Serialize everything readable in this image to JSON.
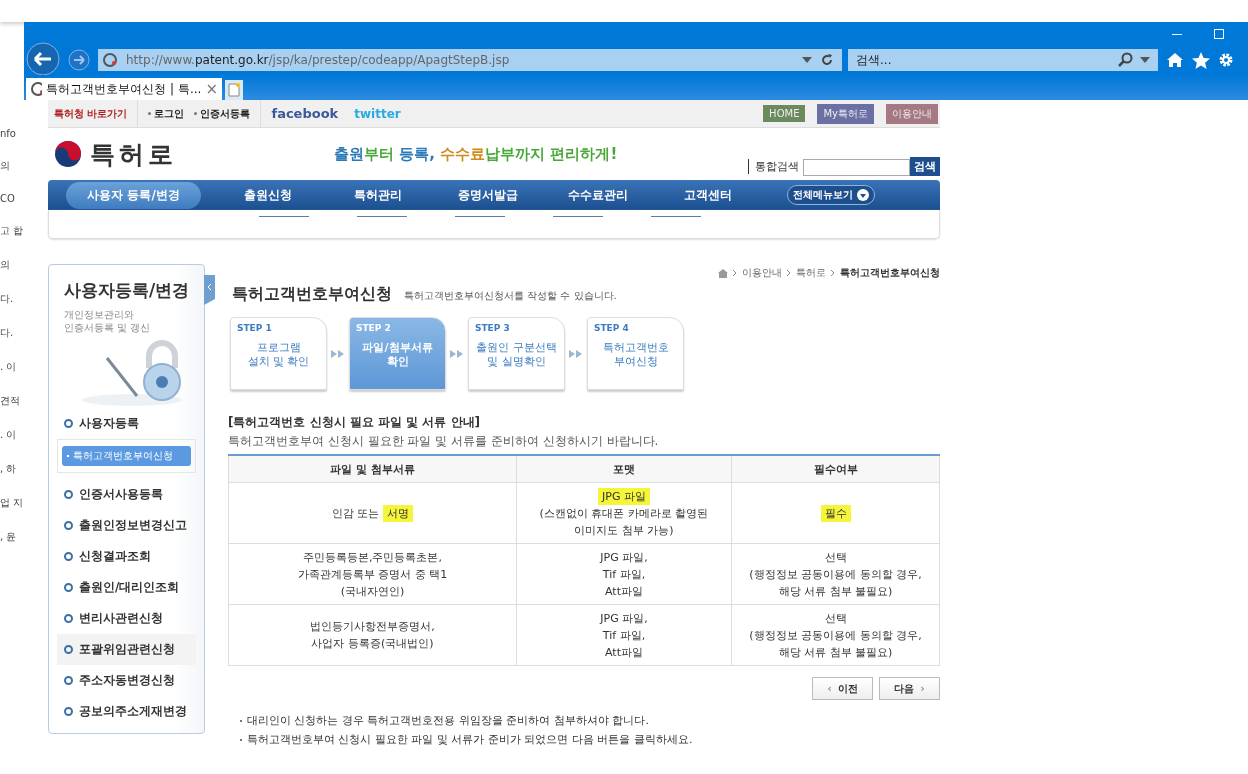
{
  "background_window": {
    "fragments": [
      "nfo",
      "의",
      "CO",
      "고 합",
      "의",
      "다.",
      "다.",
      ". 이",
      "견적",
      ". 이",
      ", 하",
      "업 지",
      ", 윤"
    ]
  },
  "browser": {
    "url": {
      "prefix": "http://www.",
      "domain": "patent.go.kr",
      "path": "/jsp/ka/prestep/codeapp/ApagtStepB.jsp"
    },
    "search": {
      "placeholder": "검색..."
    },
    "tabs": [
      {
        "title": "특허고객번호부여신청 | 특...",
        "close": "×",
        "selected": true
      }
    ]
  },
  "top_bar": {
    "shortcut": "특허청 바로가기",
    "links": [
      "로그인",
      "인증서등록"
    ],
    "social": [
      "facebook",
      "twitter"
    ],
    "buttons": [
      {
        "label": "HOME",
        "color": "#6b8a5e"
      },
      {
        "label": "My특허로",
        "color": "#6a70a3"
      },
      {
        "label": "이용안내",
        "color": "#a57882"
      }
    ]
  },
  "header": {
    "logo": "특허로",
    "slogan": [
      {
        "text": "출원",
        "color": "#2a7ab8"
      },
      {
        "text": "부터 ",
        "color": "#4aa83a"
      },
      {
        "text": "등록, ",
        "color": "#2a7ab8"
      },
      {
        "text": "수수료",
        "color": "#d08a1a"
      },
      {
        "text": "납부",
        "color": "#4aa83a"
      },
      {
        "text": "까지 편리하게!",
        "color": "#4aa83a"
      }
    ],
    "search_label": "통합검색",
    "search_button": "검색"
  },
  "nav": {
    "items": [
      {
        "label": "사용자 등록/변경",
        "selected": true
      },
      {
        "label": "출원신청",
        "selected": false
      },
      {
        "label": "특허관리",
        "selected": false
      },
      {
        "label": "증명서발급",
        "selected": false
      },
      {
        "label": "수수료관리",
        "selected": false
      },
      {
        "label": "고객센터",
        "selected": false
      }
    ],
    "all_menu": "전체메뉴보기"
  },
  "sidebar": {
    "title": "사용자등록/변경",
    "subtitle": [
      "개인정보관리와",
      "인증서등록 및 갱신"
    ],
    "items": [
      {
        "label": "사용자등록",
        "hovered": false,
        "children": [
          {
            "label": "특허고객번호부여신청",
            "selected": true
          }
        ]
      },
      {
        "label": "인증서사용등록",
        "hovered": false
      },
      {
        "label": "출원인정보변경신고",
        "hovered": false
      },
      {
        "label": "신청결과조회",
        "hovered": false
      },
      {
        "label": "출원인/대리인조회",
        "hovered": false
      },
      {
        "label": "변리사관련신청",
        "hovered": false
      },
      {
        "label": "포괄위임관련신청",
        "hovered": true
      },
      {
        "label": "주소자동변경신청",
        "hovered": false
      },
      {
        "label": "공보의주소게재변경",
        "hovered": false
      }
    ]
  },
  "breadcrumb": [
    "이용안내",
    "특허로",
    "특허고객번호부여신청"
  ],
  "page": {
    "title": "특허고객번호부여신청",
    "subtitle": "특허고객번호부여신청서를 작성할 수 있습니다."
  },
  "steps": [
    {
      "label": "STEP 1",
      "text": [
        "프로그램",
        "설치 및 확인"
      ],
      "selected": false
    },
    {
      "label": "STEP 2",
      "text": [
        "파일/첨부서류",
        "확인"
      ],
      "selected": true
    },
    {
      "label": "STEP 3",
      "text": [
        "출원인 구분선택",
        "및 실명확인"
      ],
      "selected": false
    },
    {
      "label": "STEP 4",
      "text": [
        "특허고객번호",
        "부여신청"
      ],
      "selected": false
    }
  ],
  "notice": {
    "heading": "[특허고객번호 신청시 필요 파일 및 서류 안내]",
    "description": "특허고객번호부여 신청시 필요한 파일 및 서류를 준비하여 신청하시기 바랍니다."
  },
  "table": {
    "columns": [
      "파일 및 첨부서류",
      "포맷",
      "필수여부"
    ],
    "rows": [
      [
        [
          [
            {
              "text": "인감 또는 ",
              "highlighted": false
            },
            {
              "text": "서명",
              "highlighted": true
            }
          ]
        ],
        [
          [
            {
              "text": "JPG 파일",
              "highlighted": true
            }
          ],
          [
            {
              "text": "(스캔없이 휴대폰 카메라로 촬영된",
              "highlighted": false
            }
          ],
          [
            {
              "text": "이미지도 첨부 가능)",
              "highlighted": false
            }
          ]
        ],
        [
          [
            {
              "text": "필수",
              "highlighted": true
            }
          ]
        ]
      ],
      [
        [
          [
            {
              "text": "주민등록등본,주민등록초본,",
              "highlighted": false
            }
          ],
          [
            {
              "text": "가족관계등록부 증명서 중 택1",
              "highlighted": false
            }
          ],
          [
            {
              "text": "(국내자연인)",
              "highlighted": false
            }
          ]
        ],
        [
          [
            {
              "text": "JPG 파일,",
              "highlighted": false
            }
          ],
          [
            {
              "text": "Tif 파일,",
              "highlighted": false
            }
          ],
          [
            {
              "text": "Att파일",
              "highlighted": false
            }
          ]
        ],
        [
          [
            {
              "text": "선택",
              "highlighted": false
            }
          ],
          [
            {
              "text": "(행정정보 공동이용에 동의할 경우,",
              "highlighted": false
            }
          ],
          [
            {
              "text": "해당 서류 첨부 불필요)",
              "highlighted": false
            }
          ]
        ]
      ],
      [
        [
          [
            {
              "text": "법인등기사항전부증명서,",
              "highlighted": false
            }
          ],
          [
            {
              "text": "사업자 등록증(국내법인)",
              "highlighted": false
            }
          ]
        ],
        [
          [
            {
              "text": "JPG 파일,",
              "highlighted": false
            }
          ],
          [
            {
              "text": "Tif 파일,",
              "highlighted": false
            }
          ],
          [
            {
              "text": "Att파일",
              "highlighted": false
            }
          ]
        ],
        [
          [
            {
              "text": "선택",
              "highlighted": false
            }
          ],
          [
            {
              "text": "(행정정보 공동이용에 동의할 경우,",
              "highlighted": false
            }
          ],
          [
            {
              "text": "해당 서류 첨부 불필요)",
              "highlighted": false
            }
          ]
        ]
      ]
    ]
  },
  "buttons": [
    {
      "kind": "prev",
      "label": "이전",
      "arrow": "‹"
    },
    {
      "kind": "next",
      "label": "다음",
      "arrow": "›"
    }
  ],
  "notes": [
    "대리인이 신청하는 경우 특허고객번호전용 위임장을 준비하여 첨부하셔야 합니다.",
    "특허고객번호부여 신청시 필요한 파일 및 서류가 준비가 되었으면 다음 버튼을 클릭하세요."
  ]
}
